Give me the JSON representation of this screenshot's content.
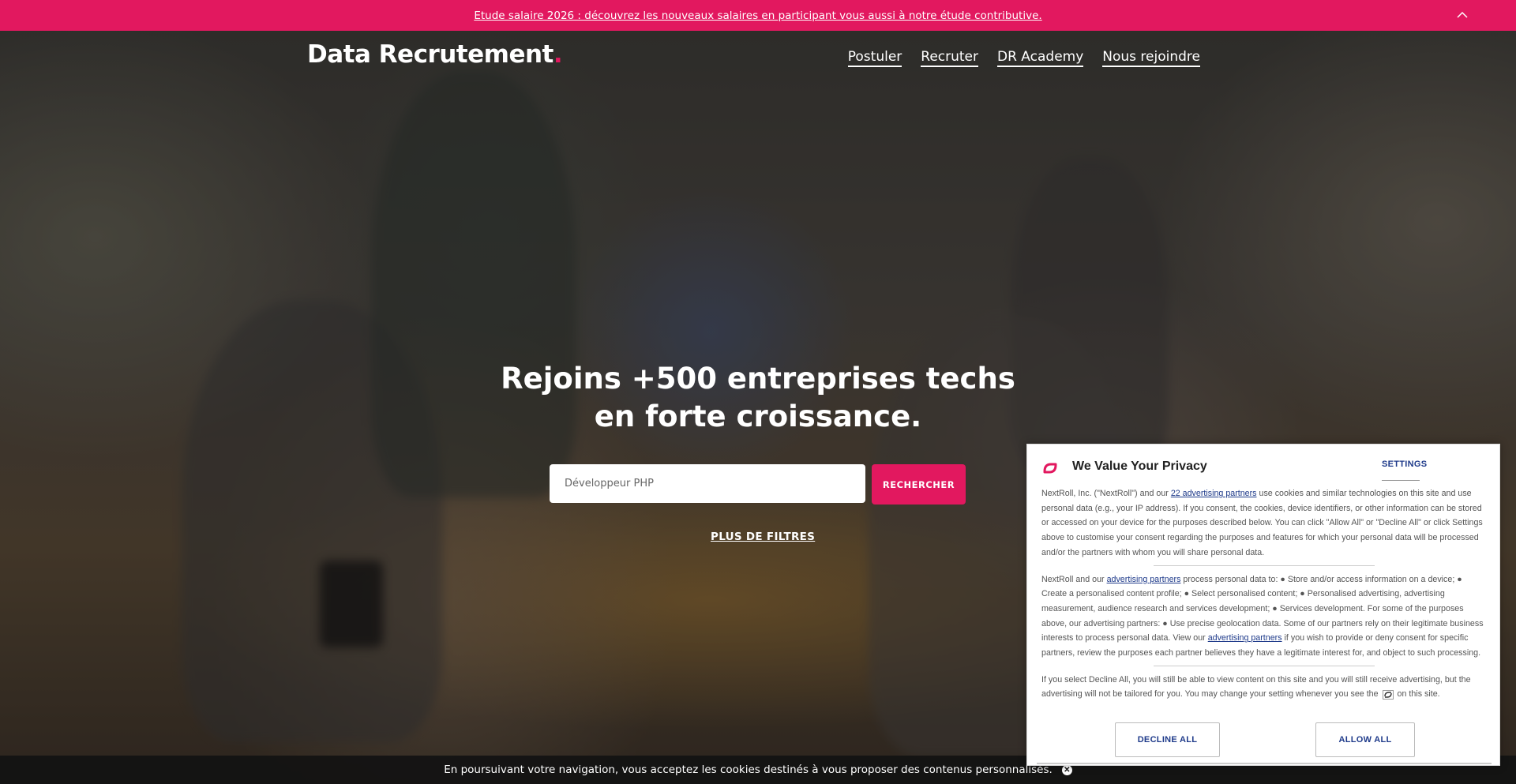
{
  "banner": {
    "text": "Etude salaire 2026 : découvrez les nouveaux salaires en participant vous aussi à notre étude contributive.",
    "collapse_icon": "chevron-up-icon",
    "bg_color": "#e2185f"
  },
  "header": {
    "logo_text": "Data Recrutement",
    "logo_dot": ".",
    "nav": [
      "Postuler",
      "Recruter",
      "DR Academy",
      "Nous rejoindre"
    ]
  },
  "hero": {
    "title_line1": "Rejoins +500 entreprises techs",
    "title_line2": "en forte croissance.",
    "search_placeholder": "Développeur PHP",
    "search_button": "RECHERCHER",
    "more_filters": "PLUS DE FILTRES"
  },
  "cookie_bar": {
    "text": "En poursuivant votre navigation, vous acceptez les cookies destinés à vous proposer des contenus personnalisés.",
    "close_icon": "close-icon"
  },
  "privacy": {
    "title": "We Value Your Privacy",
    "settings": "SETTINGS",
    "p1_a": "NextRoll, Inc. (\"NextRoll\") and our ",
    "p1_link": "22 advertising partners",
    "p1_b": " use cookies and similar technologies on this site and use personal data (e.g., your IP address). If you consent, the cookies, device identifiers, or other information can be stored or accessed on your device for the purposes described below. You can click \"Allow All\" or \"Decline All\" or click Settings above to customise your consent regarding the purposes and features for which your personal data will be processed and/or the partners with whom you will share personal data.",
    "p2_a": "NextRoll and our ",
    "p2_link1": "advertising partners",
    "p2_b": " process personal data to: ● Store and/or access information on a device; ● Create a personalised content profile; ● Select personalised content; ● Personalised advertising, advertising measurement, audience research and services development; ● Services development. For some of the purposes above, our advertising partners: ● Use precise geolocation data. Some of our partners rely on their legitimate business interests to process personal data. View our ",
    "p2_link2": "advertising partners",
    "p2_c": " if you wish to provide or deny consent for specific partners, review the purposes each partner believes they have a legitimate interest for, and object to such processing.",
    "p3_a": "If you select Decline All, you will still be able to view content on this site and you will still receive advertising, but the advertising will not be tailored for you. You may change your setting whenever you see the",
    "p3_b": "on this site.",
    "decline": "DECLINE ALL",
    "allow": "ALLOW ALL",
    "logo_icon": "nextroll-logo-icon",
    "accent_color": "#e2185f",
    "link_color": "#1e3a8a"
  }
}
